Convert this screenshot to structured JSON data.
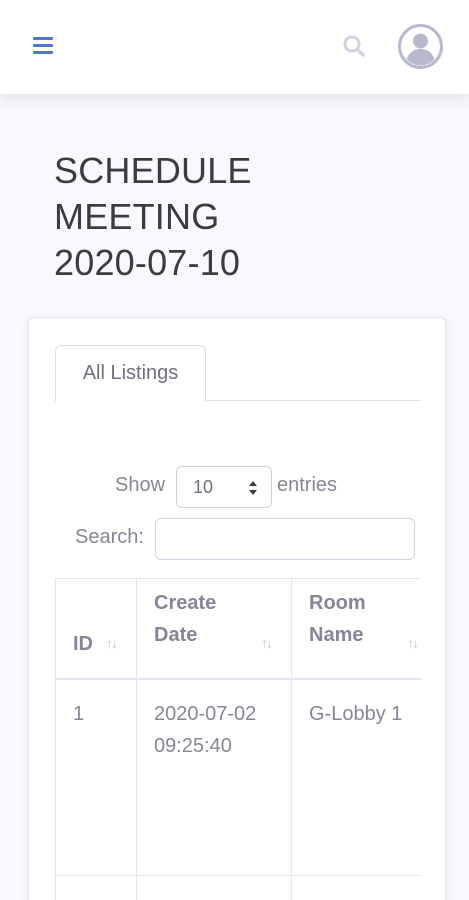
{
  "topbar": {
    "menu_icon": "hamburger-icon",
    "search_icon": "search-icon",
    "avatar_icon": "user-avatar-icon",
    "accent_color": "#4e73df"
  },
  "page": {
    "title_line1": "SCHEDULE",
    "title_line2": "MEETING",
    "title_line3": "2020-07-10"
  },
  "tabs": [
    {
      "label": "All Listings",
      "active": true
    }
  ],
  "table_controls": {
    "show_label": "Show",
    "entries_value": "10",
    "entries_label": "entries",
    "search_label": "Search:",
    "search_value": ""
  },
  "table": {
    "columns": [
      {
        "label": "ID"
      },
      {
        "label": "Create Date"
      },
      {
        "label": "Room Name"
      }
    ],
    "rows": [
      {
        "id": "1",
        "create_date": "2020-07-02 09:25:40",
        "room_name": "G-Lobby 1"
      }
    ]
  }
}
